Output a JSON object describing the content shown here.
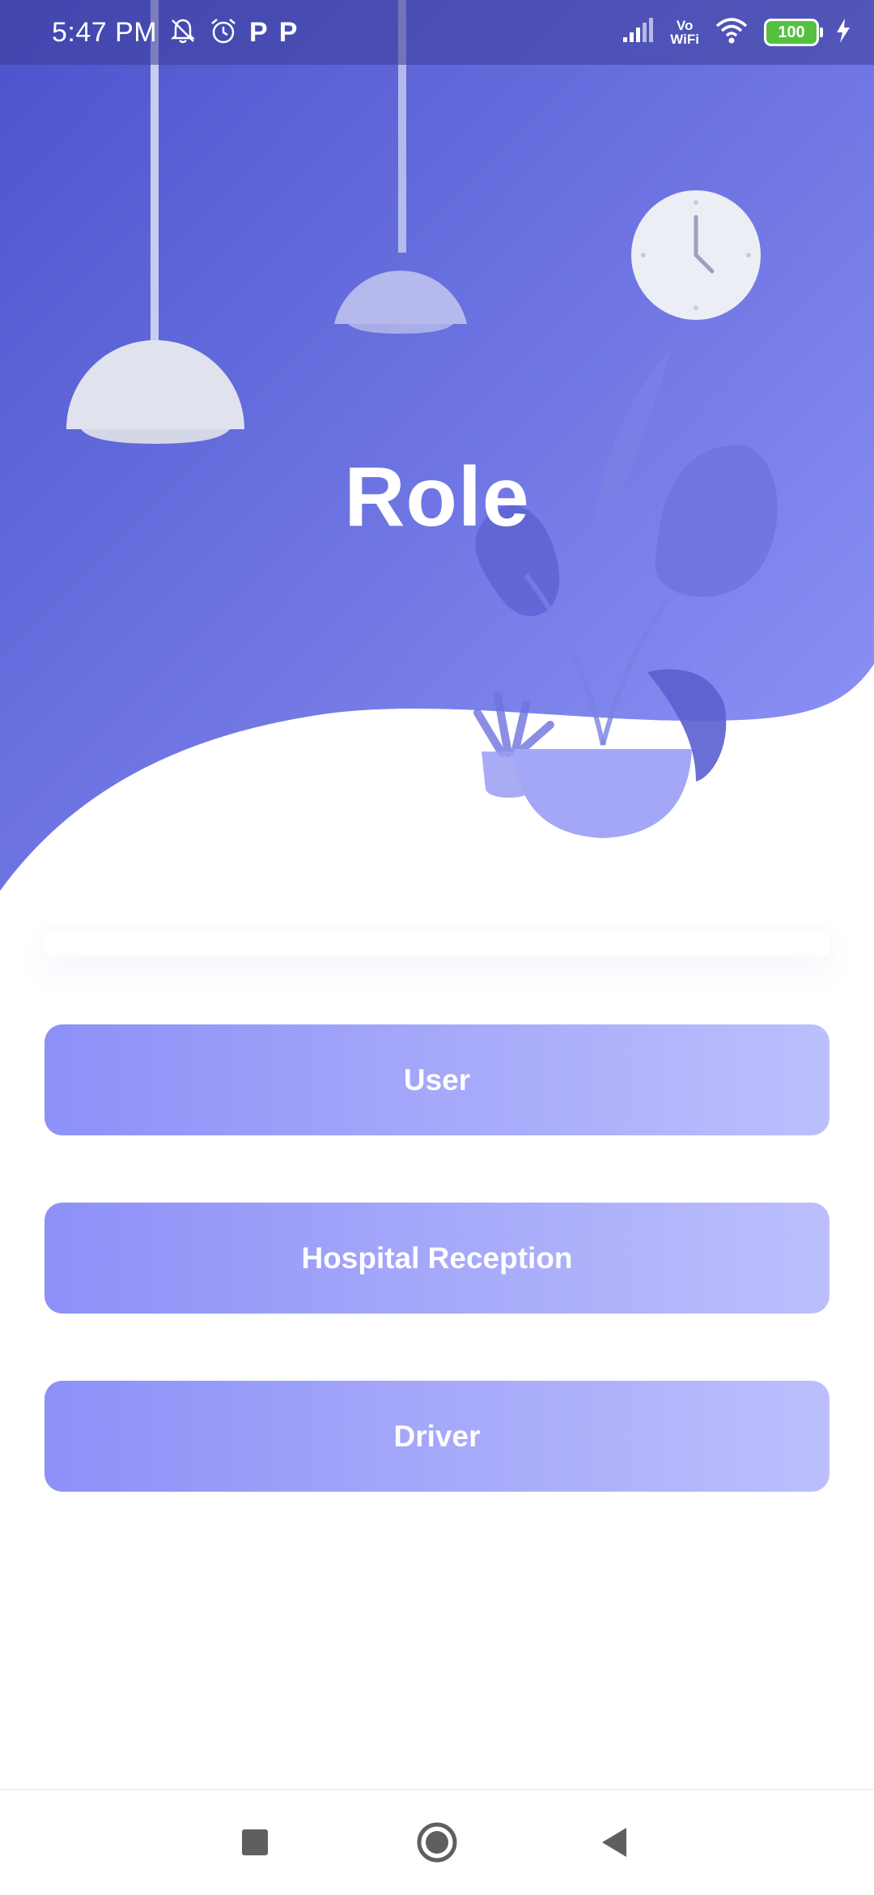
{
  "status_bar": {
    "time": "5:47 PM",
    "left_icons": [
      "mute-bell-icon",
      "alarm-icon",
      "parking-app-icon",
      "parking-app-icon"
    ],
    "p_glyph": "P",
    "vowifi_line1": "Vo",
    "vowifi_line2": "WiFi",
    "battery_level": "100"
  },
  "page": {
    "title": "Role"
  },
  "roles": {
    "user_label": "User",
    "hospital_label": "Hospital Reception",
    "driver_label": "Driver"
  },
  "nav": {
    "icons": [
      "recents-square-icon",
      "home-circle-icon",
      "back-triangle-icon"
    ]
  },
  "colors": {
    "header_gradient_start": "#4b53cc",
    "header_gradient_end": "#8c92f7",
    "button_gradient_start": "#8d90f7",
    "button_gradient_end": "#bcbffc",
    "battery_fill": "#55c040"
  }
}
